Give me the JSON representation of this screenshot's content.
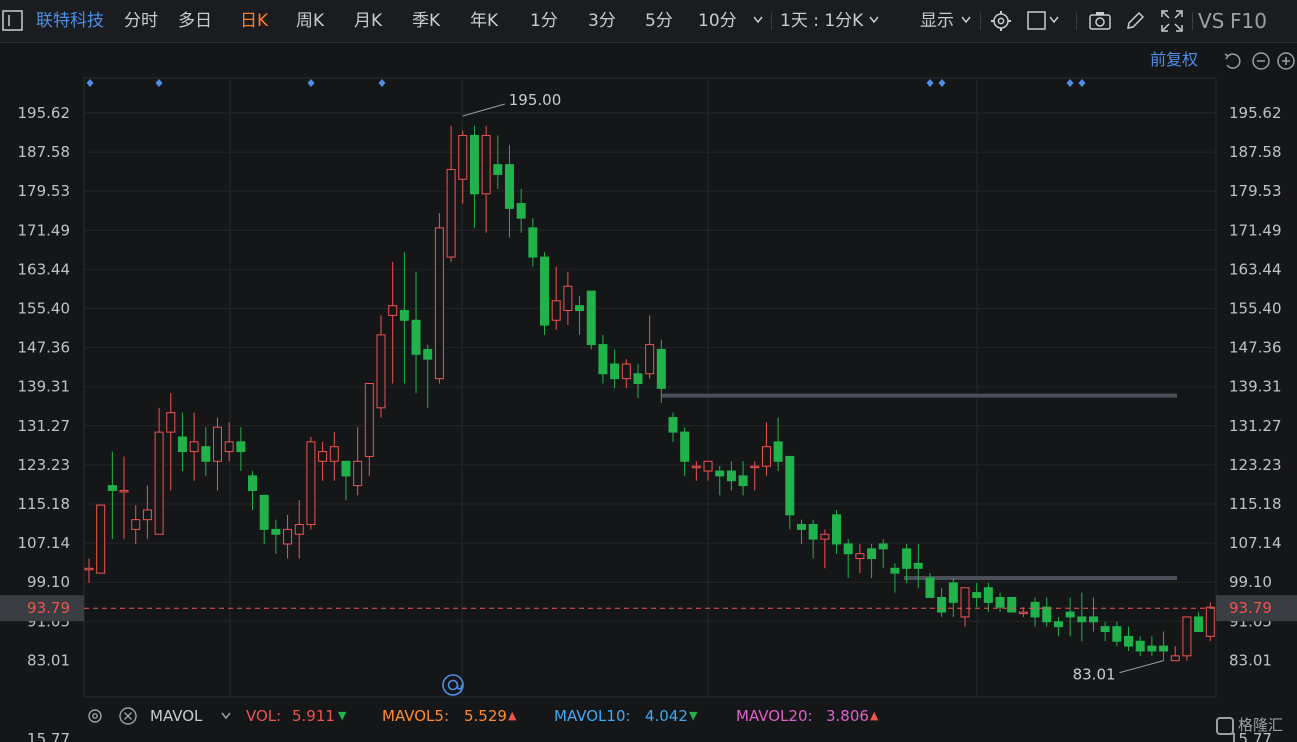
{
  "topbar": {
    "stock_name": "联特科技",
    "tabs": [
      "分时",
      "多日",
      "日K",
      "周K",
      "月K",
      "季K",
      "年K",
      "1分",
      "3分",
      "5分",
      "10分"
    ],
    "active_tab": "日K",
    "period_select": "1天 : 1分K",
    "display_label": "显示",
    "vs_label": "VS",
    "f10_label": "F10"
  },
  "subbar": {
    "adjust_label": "前复权"
  },
  "price_axis": {
    "labels": [
      "195.62",
      "187.58",
      "179.53",
      "171.49",
      "163.44",
      "155.40",
      "147.36",
      "139.31",
      "131.27",
      "123.23",
      "115.18",
      "107.14",
      "99.10",
      "91.05",
      "83.01",
      "15.77"
    ],
    "current_price": "93.79"
  },
  "annotations": {
    "high_label": "195.00",
    "low_label": "83.01"
  },
  "volume_bar": {
    "indicator": "MAVOL",
    "vol_label": "VOL:",
    "vol_value": "5.911",
    "mavol5_label": "MAVOL5:",
    "mavol5_value": "5.529",
    "mavol10_label": "MAVOL10:",
    "mavol10_value": "4.042",
    "mavol20_label": "MAVOL20:",
    "mavol20_value": "3.806"
  },
  "colors": {
    "up": "#ef5350",
    "down": "#21b24b",
    "accent": "#ff7d1f",
    "brand": "#4f8fe8"
  },
  "watermark": "格隆汇",
  "chart_data": {
    "type": "candlestick",
    "ylim": [
      79,
      199
    ],
    "support_lines": [
      137.5,
      100.0
    ],
    "candles": [
      [
        102,
        104,
        99,
        102
      ],
      [
        101,
        115,
        101,
        115
      ],
      [
        119,
        126,
        108,
        118
      ],
      [
        118,
        125,
        108,
        118
      ],
      [
        110,
        115,
        107,
        112
      ],
      [
        112,
        119,
        108,
        114
      ],
      [
        109,
        135,
        109,
        130
      ],
      [
        130,
        138,
        118,
        134
      ],
      [
        129,
        134,
        122,
        126
      ],
      [
        126,
        134,
        120,
        128
      ],
      [
        127,
        131,
        121,
        124
      ],
      [
        124,
        133,
        118,
        131
      ],
      [
        126,
        132,
        124,
        128
      ],
      [
        128,
        131,
        122,
        126
      ],
      [
        121,
        122,
        114,
        118
      ],
      [
        117,
        117,
        107,
        110
      ],
      [
        110,
        112,
        105,
        109
      ],
      [
        107,
        113,
        104,
        110
      ],
      [
        109,
        116,
        104,
        111
      ],
      [
        111,
        129,
        110,
        128
      ],
      [
        124,
        128,
        120,
        126
      ],
      [
        124,
        130,
        120,
        127
      ],
      [
        124,
        124,
        116,
        121
      ],
      [
        119,
        131,
        117,
        124
      ],
      [
        125,
        130,
        121,
        140
      ],
      [
        135,
        154,
        133,
        150
      ],
      [
        154,
        165,
        140,
        156
      ],
      [
        155,
        167,
        140,
        153
      ],
      [
        153,
        163,
        138,
        146
      ],
      [
        147,
        148,
        135,
        145
      ],
      [
        141,
        175,
        140,
        172
      ],
      [
        166,
        193,
        165,
        184
      ],
      [
        182,
        192,
        177,
        191
      ],
      [
        191,
        193,
        172,
        179
      ],
      [
        179,
        193,
        171,
        191
      ],
      [
        185,
        191,
        180,
        183
      ],
      [
        185,
        189,
        170,
        176
      ],
      [
        177,
        180,
        171,
        174
      ],
      [
        172,
        174,
        164,
        166
      ],
      [
        166,
        167,
        150,
        152
      ],
      [
        153,
        164,
        151,
        157
      ],
      [
        155,
        163,
        152,
        160
      ],
      [
        156,
        158,
        150,
        155
      ],
      [
        159,
        159,
        147,
        148
      ],
      [
        148,
        150,
        140,
        142
      ],
      [
        144,
        147,
        139,
        141
      ],
      [
        141,
        145,
        139,
        144
      ],
      [
        142,
        144,
        137,
        140
      ],
      [
        142,
        154,
        141,
        148
      ],
      [
        147,
        149,
        136,
        139
      ],
      [
        133,
        134,
        128,
        130
      ],
      [
        130,
        131,
        121,
        124
      ],
      [
        123,
        124,
        120,
        123
      ],
      [
        122,
        124,
        120,
        124
      ],
      [
        122,
        123,
        117,
        121
      ],
      [
        122,
        124,
        118,
        120
      ],
      [
        121,
        124,
        117,
        119
      ],
      [
        123,
        124,
        118,
        123
      ],
      [
        123,
        132,
        121,
        127
      ],
      [
        128,
        133,
        122,
        124
      ],
      [
        125,
        125,
        110,
        113
      ],
      [
        111,
        112,
        107,
        110
      ],
      [
        111,
        112,
        104,
        108
      ],
      [
        108,
        110,
        102,
        109
      ],
      [
        113,
        114,
        105,
        107
      ],
      [
        107,
        108,
        100,
        105
      ],
      [
        104,
        107,
        101,
        105
      ],
      [
        106,
        107,
        100,
        104
      ],
      [
        107,
        108,
        102,
        106
      ],
      [
        102,
        103,
        97,
        101
      ],
      [
        106,
        107,
        99,
        102
      ],
      [
        103,
        107,
        98,
        102
      ],
      [
        100,
        101,
        96,
        96
      ],
      [
        96,
        98,
        92,
        93
      ],
      [
        99,
        100,
        92,
        95
      ],
      [
        92,
        98,
        90,
        98
      ],
      [
        97,
        99,
        94,
        96
      ],
      [
        98,
        99,
        93,
        95
      ],
      [
        96,
        97,
        93,
        94
      ],
      [
        96,
        96,
        93,
        93
      ],
      [
        93,
        94,
        92,
        93
      ],
      [
        95,
        96,
        90,
        92
      ],
      [
        94,
        96,
        90,
        91
      ],
      [
        91,
        92,
        88,
        90
      ],
      [
        93,
        96,
        88,
        92
      ],
      [
        92,
        97,
        87,
        91
      ],
      [
        92,
        96,
        89,
        91
      ],
      [
        90,
        91,
        87,
        89
      ],
      [
        90,
        91,
        86,
        87
      ],
      [
        88,
        90,
        85,
        86
      ],
      [
        87,
        88,
        84,
        85
      ],
      [
        86,
        88,
        84,
        85
      ],
      [
        86,
        89,
        83,
        85
      ],
      [
        83,
        86,
        83,
        84
      ],
      [
        84,
        92,
        83,
        92
      ],
      [
        92,
        93,
        89,
        89
      ],
      [
        88,
        95,
        87,
        94
      ]
    ]
  }
}
